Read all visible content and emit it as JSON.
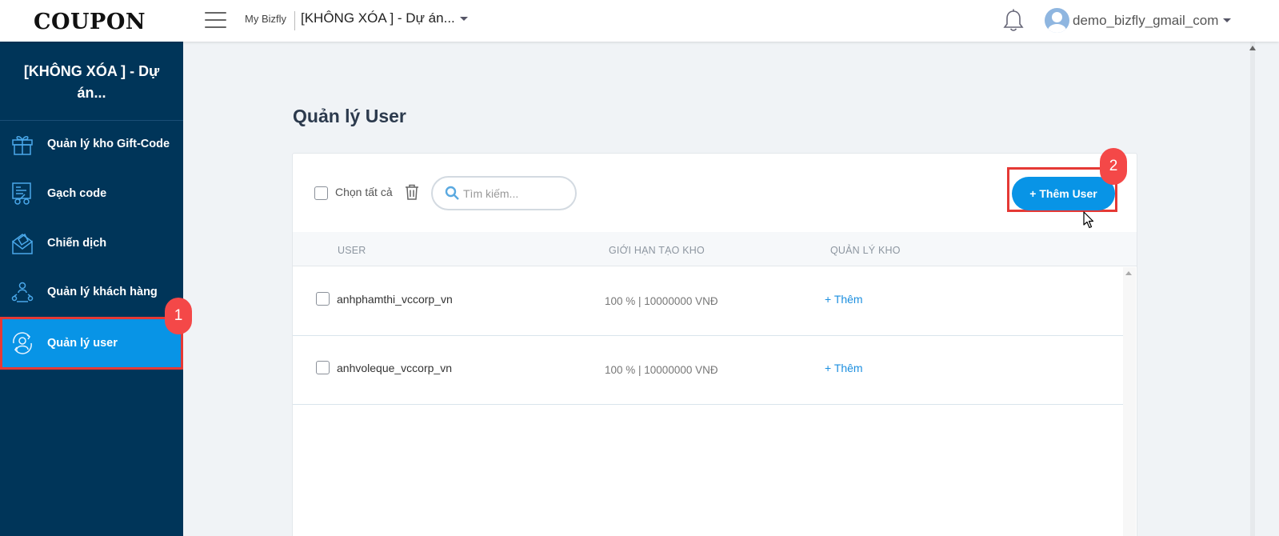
{
  "header": {
    "logo": "COUPON",
    "brand": "My Bizfly",
    "project": "[KHÔNG XÓA ] - Dự án...",
    "username": "demo_bizfly_gmail_com"
  },
  "sidebar": {
    "title_line1": "[KHÔNG XÓA ] - Dự",
    "title_line2": "án...",
    "items": [
      {
        "label": "Quản lý kho Gift-Code",
        "icon": "gift-icon"
      },
      {
        "label": "Gạch code",
        "icon": "code-scan-icon"
      },
      {
        "label": "Chiến dịch",
        "icon": "campaign-icon"
      },
      {
        "label": "Quản lý khách hàng",
        "icon": "customers-icon"
      },
      {
        "label": "Quản lý user",
        "icon": "user-sync-icon",
        "active": true
      }
    ]
  },
  "annotations": {
    "badge_1": "1",
    "badge_2": "2"
  },
  "main": {
    "title": "Quản lý User",
    "select_all": "Chọn tất cả",
    "search_placeholder": "Tìm kiếm...",
    "add_button": "+ Thêm User"
  },
  "table": {
    "columns": [
      "USER",
      "GIỚI HẠN TẠO KHO",
      "QUẢN LÝ KHO"
    ],
    "rows": [
      {
        "user": "anhphamthi_vccorp_vn",
        "limit": "100 % | 10000000 VNĐ",
        "action": "+ Thêm"
      },
      {
        "user": "anhvoleque_vccorp_vn",
        "limit": "100 % | 10000000 VNĐ",
        "action": "+ Thêm"
      }
    ]
  },
  "colors": {
    "sidebar": "#003559",
    "accent": "#0894e6",
    "highlight": "#e53935",
    "badge": "#f44848"
  }
}
